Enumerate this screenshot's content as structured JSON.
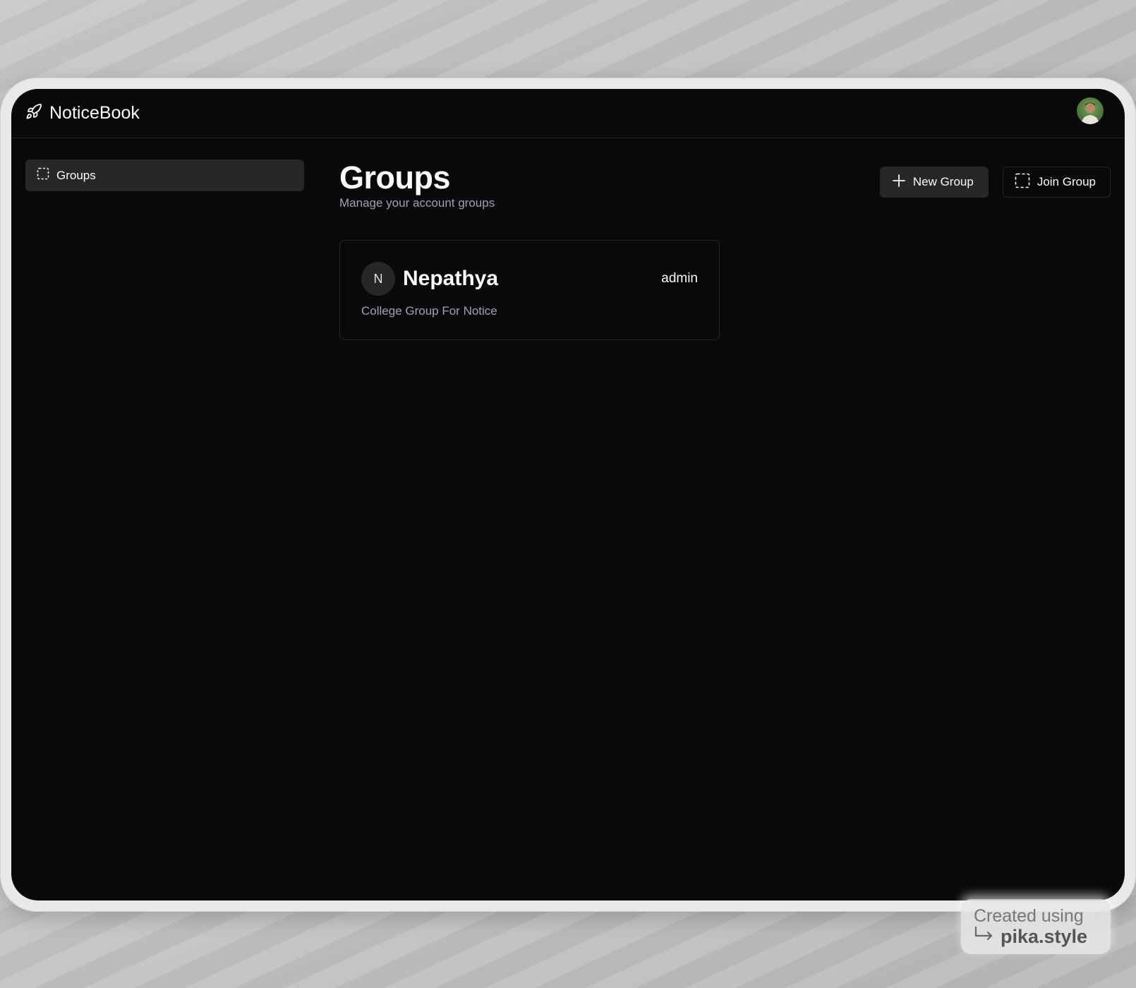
{
  "app": {
    "name": "NoticeBook",
    "logo_icon": "rocket-icon"
  },
  "sidebar": {
    "items": [
      {
        "label": "Groups",
        "icon": "dashed-square-icon",
        "active": true
      }
    ]
  },
  "main": {
    "title": "Groups",
    "subtitle": "Manage your account groups",
    "actions": {
      "new_group": "New Group",
      "join_group": "Join Group"
    },
    "groups": [
      {
        "initial": "N",
        "name": "Nepathya",
        "role": "admin",
        "description": "College Group For Notice"
      }
    ]
  },
  "watermark": {
    "line1": "Created using",
    "line2": "pika.style"
  },
  "colors": {
    "background": "#09090b",
    "surface": "#27272a",
    "border": "#27272a",
    "muted_text": "#a1a1aa",
    "text": "#fafafa"
  }
}
